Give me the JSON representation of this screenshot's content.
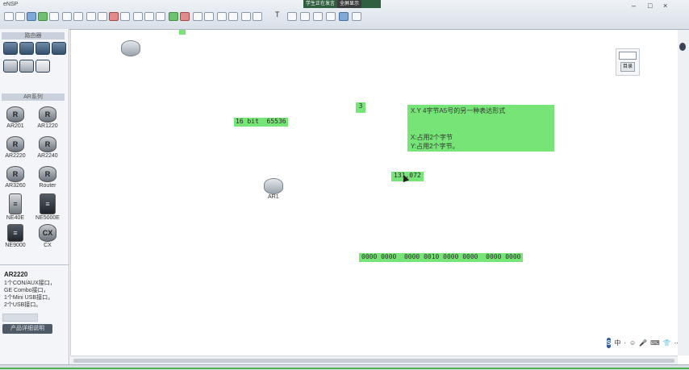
{
  "app": {
    "logo_text": "eNSP"
  },
  "banner": {
    "left": "学生正在发言",
    "right": "全屏显示"
  },
  "toolbar": {
    "text_tool": "T",
    "window_controls": [
      "–",
      "□",
      "×"
    ]
  },
  "left_panel": {
    "top_header": "路由器",
    "list_header": "AR系列",
    "devices": [
      {
        "label": "AR201",
        "glyph": "R"
      },
      {
        "label": "AR1220",
        "glyph": "R"
      },
      {
        "label": "AR2220",
        "glyph": "R"
      },
      {
        "label": "AR2240",
        "glyph": "R"
      },
      {
        "label": "AR3260",
        "glyph": "R"
      },
      {
        "label": "Router",
        "glyph": "R"
      },
      {
        "label": "NE40E",
        "glyph": "≡"
      },
      {
        "label": "NE5000E",
        "glyph": "≡"
      },
      {
        "label": "NE9000",
        "glyph": "≡"
      },
      {
        "label": "CX",
        "glyph": "CX"
      }
    ],
    "info": {
      "title": "AR2220",
      "lines": [
        "1个CON/AUX接口，",
        "GE Combo接口，",
        "1个Mini USB接口，",
        "2个USB接口。"
      ],
      "dark_button": "产品详细说明"
    }
  },
  "canvas": {
    "router_label": "AR1",
    "notes": {
      "bits": "16 bit  65536",
      "three": "3",
      "big_line1": "X.Y   4字节A5号的另一种表达形式",
      "big_line2": "X:占用2个字节",
      "big_line3": "Y:占用2个字节。",
      "value": "131,072",
      "binary": "0000 0000  0000 0010 0000 0000  0000 0000"
    },
    "mini_widget_button": "目录"
  },
  "ime_bar": {
    "logo": "S",
    "items": [
      "中",
      "·",
      "☺",
      "🎤",
      "⌨",
      "👕",
      "⋯"
    ]
  },
  "colors": {
    "note_green": "#77e477",
    "toolbar": "#dfe5ec"
  }
}
